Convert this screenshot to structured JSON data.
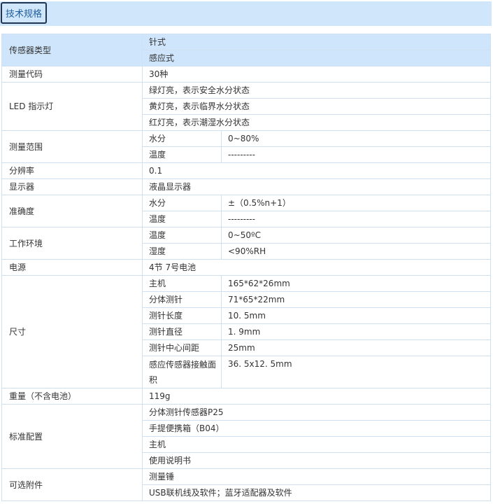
{
  "tab": {
    "label": "技术规格"
  },
  "rows": {
    "sensor_type": {
      "label": "传感器类型",
      "v1": "针式",
      "v2": "感应式"
    },
    "code": {
      "label": "测量代码",
      "v": "30种"
    },
    "led": {
      "label": "LED 指示灯",
      "v1": "绿灯亮，表示安全水分状态",
      "v2": "黄灯亮，表示临界水分状态",
      "v3": "红灯亮，表示潮湿水分状态"
    },
    "range": {
      "label": "测量范围",
      "k1": "水分",
      "v1": "0~80%",
      "k2": "温度",
      "v2": "---------"
    },
    "resolution": {
      "label": "分辨率",
      "v": "0.1"
    },
    "display": {
      "label": "显示器",
      "v": "液晶显示器"
    },
    "accuracy": {
      "label": "准确度",
      "k1": "水分",
      "v1": "±（0.5%n+1）",
      "k2": "温度",
      "v2": "---------"
    },
    "env": {
      "label": "工作环境",
      "k1": "温度",
      "v1": "0~50ºC",
      "k2": "湿度",
      "v2": "<90%RH"
    },
    "power": {
      "label": "电源",
      "v": "4节 7号电池"
    },
    "size": {
      "label": "尺寸",
      "items": [
        {
          "k": "主机",
          "v": "165*62*26mm"
        },
        {
          "k": "分体测针",
          "v": "71*65*22mm"
        },
        {
          "k": "测针长度",
          "v": "10. 5mm"
        },
        {
          "k": "测针直径",
          "v": "1. 9mm"
        },
        {
          "k": "测针中心间距",
          "v": "25mm"
        },
        {
          "k": "感应传感器接触面积",
          "v": "36. 5x12. 5mm"
        }
      ]
    },
    "weight": {
      "label": "重量（不含电池）",
      "v": "119g"
    },
    "standard": {
      "label": "标准配置",
      "v1": "分体测针传感器P25",
      "v2": "手提便携箱（B04）",
      "v3": "主机",
      "v4": "使用说明书"
    },
    "optional": {
      "label": "可选附件",
      "v1": "测量锤",
      "v2": "USB联机线及软件；蓝牙适配器及软件"
    }
  }
}
